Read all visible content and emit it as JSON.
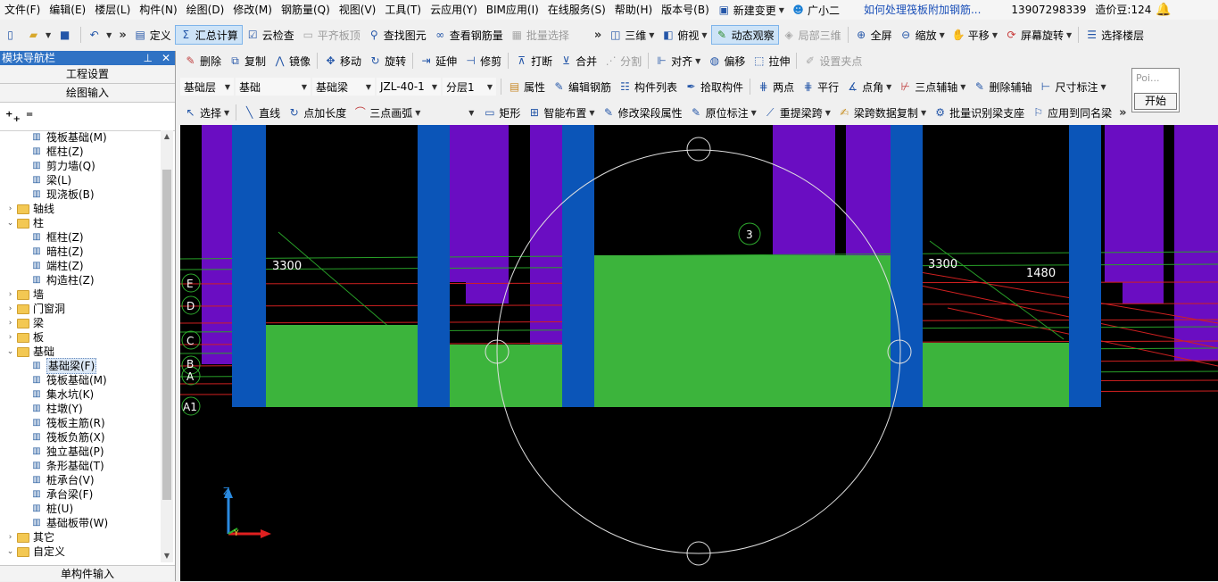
{
  "menubar": {
    "items": [
      "文件(F)",
      "编辑(E)",
      "楼层(L)",
      "构件(N)",
      "绘图(D)",
      "修改(M)",
      "钢筋量(Q)",
      "视图(V)",
      "工具(T)",
      "云应用(Y)",
      "BIM应用(I)",
      "在线服务(S)",
      "帮助(H)",
      "版本号(B)"
    ],
    "new_change": "新建变更",
    "assistant": "广小二",
    "question_link": "如何处理筏板附加钢筋...",
    "phone": "13907298339",
    "cost_beans": "造价豆:124"
  },
  "toolbar1": {
    "define": "定义",
    "summary_calc": "汇总计算",
    "cloud_check": "云检查",
    "flat_top": "平齐板顶",
    "find_element": "查找图元",
    "view_rebar": "查看钢筋量",
    "batch_select": "批量选择",
    "view_3d": "三维",
    "top_view": "俯视",
    "dynamic_observe": "动态观察",
    "local_3d": "局部三维",
    "full_screen": "全屏",
    "zoom": "缩放",
    "pan": "平移",
    "screen_rotate": "屏幕旋转",
    "select_floor": "选择楼层"
  },
  "toolbar2": {
    "delete": "删除",
    "copy": "复制",
    "mirror": "镜像",
    "move": "移动",
    "rotate": "旋转",
    "extend": "延伸",
    "trim": "修剪",
    "break": "打断",
    "merge": "合并",
    "split": "分割",
    "align": "对齐",
    "offset": "偏移",
    "stretch": "拉伸",
    "set_grip": "设置夹点"
  },
  "toolbar3": {
    "combo_floor": "基础层",
    "combo_category": "基础",
    "combo_type": "基础梁",
    "combo_element": "JZL-40-1",
    "combo_layer": "分层1",
    "properties": "属性",
    "edit_rebar": "编辑钢筋",
    "element_list": "构件列表",
    "pick_element": "拾取构件",
    "two_points": "两点",
    "parallel": "平行",
    "point_angle": "点角",
    "three_point_axis": "三点辅轴",
    "delete_axis": "删除辅轴",
    "dimension": "尺寸标注"
  },
  "toolbar4": {
    "select": "选择",
    "line": "直线",
    "point_length": "点加长度",
    "arc": "三点画弧",
    "rectangle": "矩形",
    "smart_layout": "智能布置",
    "modify_span": "修改梁段属性",
    "in_situ_label": "原位标注",
    "re_extract_span": "重提梁跨",
    "span_copy": "梁跨数据复制",
    "batch_identify": "批量识别梁支座",
    "apply_same": "应用到同名梁"
  },
  "popup": {
    "title": "Poi...",
    "start": "开始"
  },
  "left_panel": {
    "title": "模块导航栏",
    "project_settings": "工程设置",
    "drawing_input": "绘图输入",
    "single_input": "单构件输入",
    "tree": [
      {
        "label": "筏板基础(M)",
        "level": 2,
        "type": "item",
        "icon": "raft-foundation-icon"
      },
      {
        "label": "框柱(Z)",
        "level": 2,
        "type": "item",
        "icon": "column-icon"
      },
      {
        "label": "剪力墙(Q)",
        "level": 2,
        "type": "item",
        "icon": "shear-wall-icon"
      },
      {
        "label": "梁(L)",
        "level": 2,
        "type": "item",
        "icon": "beam-icon"
      },
      {
        "label": "现浇板(B)",
        "level": 2,
        "type": "item",
        "icon": "slab-icon"
      },
      {
        "label": "轴线",
        "level": 1,
        "type": "folder",
        "expanded": false
      },
      {
        "label": "柱",
        "level": 1,
        "type": "folder",
        "expanded": true
      },
      {
        "label": "框柱(Z)",
        "level": 2,
        "type": "item",
        "icon": "column-icon"
      },
      {
        "label": "暗柱(Z)",
        "level": 2,
        "type": "item",
        "icon": "column-icon"
      },
      {
        "label": "端柱(Z)",
        "level": 2,
        "type": "item",
        "icon": "column-icon"
      },
      {
        "label": "构造柱(Z)",
        "level": 2,
        "type": "item",
        "icon": "constructional-column-icon"
      },
      {
        "label": "墙",
        "level": 1,
        "type": "folder",
        "expanded": false
      },
      {
        "label": "门窗洞",
        "level": 1,
        "type": "folder",
        "expanded": false
      },
      {
        "label": "梁",
        "level": 1,
        "type": "folder",
        "expanded": false
      },
      {
        "label": "板",
        "level": 1,
        "type": "folder",
        "expanded": false
      },
      {
        "label": "基础",
        "level": 1,
        "type": "folder",
        "expanded": true
      },
      {
        "label": "基础梁(F)",
        "level": 2,
        "type": "item",
        "icon": "foundation-beam-icon",
        "selected": true
      },
      {
        "label": "筏板基础(M)",
        "level": 2,
        "type": "item",
        "icon": "raft-foundation-icon"
      },
      {
        "label": "集水坑(K)",
        "level": 2,
        "type": "item",
        "icon": "sump-pit-icon"
      },
      {
        "label": "柱墩(Y)",
        "level": 2,
        "type": "item",
        "icon": "column-pier-icon"
      },
      {
        "label": "筏板主筋(R)",
        "level": 2,
        "type": "item",
        "icon": "raft-main-rebar-icon"
      },
      {
        "label": "筏板负筋(X)",
        "level": 2,
        "type": "item",
        "icon": "raft-negative-rebar-icon"
      },
      {
        "label": "独立基础(P)",
        "level": 2,
        "type": "item",
        "icon": "isolated-foundation-icon"
      },
      {
        "label": "条形基础(T)",
        "level": 2,
        "type": "item",
        "icon": "strip-foundation-icon"
      },
      {
        "label": "桩承台(V)",
        "level": 2,
        "type": "item",
        "icon": "pile-cap-icon"
      },
      {
        "label": "承台梁(F)",
        "level": 2,
        "type": "item",
        "icon": "cap-beam-icon"
      },
      {
        "label": "桩(U)",
        "level": 2,
        "type": "item",
        "icon": "pile-icon"
      },
      {
        "label": "基础板带(W)",
        "level": 2,
        "type": "item",
        "icon": "foundation-strip-icon"
      },
      {
        "label": "其它",
        "level": 1,
        "type": "folder",
        "expanded": false
      },
      {
        "label": "自定义",
        "level": 1,
        "type": "folder",
        "expanded": true
      }
    ]
  },
  "viewport": {
    "background": "#000000",
    "column_color": "#0b55b8",
    "wall_color": "#6a0dc2",
    "beam_color": "#3cb43c",
    "dim_labels": [
      "3300",
      "3300",
      "1480"
    ],
    "axis_labels": [
      "E",
      "D",
      "C",
      "B",
      "A",
      "A1"
    ],
    "orbit_marker": "3",
    "axis_z": "Z",
    "axis_y": "Y"
  }
}
